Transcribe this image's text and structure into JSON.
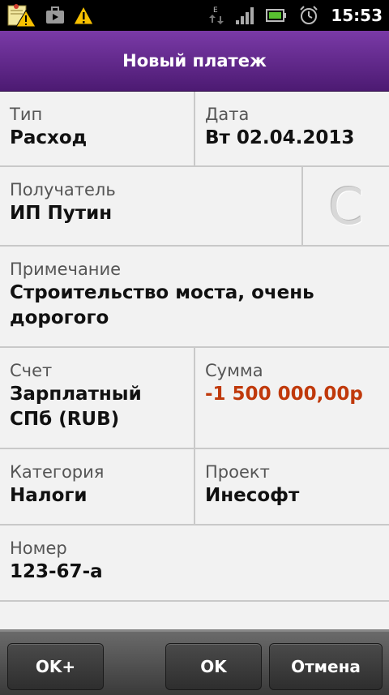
{
  "status_bar": {
    "time": "15:53",
    "icons": [
      "note-warning-icon",
      "briefcase-icon",
      "warning-icon",
      "data-arrows-icon",
      "signal-icon",
      "battery-icon",
      "alarm-icon"
    ],
    "network_type": "E"
  },
  "header": {
    "title": "Новый платеж"
  },
  "form": {
    "type": {
      "label": "Тип",
      "value": "Расход"
    },
    "date": {
      "label": "Дата",
      "value": "Вт 02.04.2013"
    },
    "recipient": {
      "label": "Получатель",
      "value": "ИП Путин"
    },
    "contact_button_glyph": "C",
    "note": {
      "label": "Примечание",
      "value": "Строительство моста, очень дорогого"
    },
    "account": {
      "label": "Счет",
      "value": "Зарплатный СПб (RUB)"
    },
    "amount": {
      "label": "Сумма",
      "value": "-1 500 000,00р"
    },
    "category": {
      "label": "Категория",
      "value": "Налоги"
    },
    "project": {
      "label": "Проект",
      "value": "Инесофт"
    },
    "number": {
      "label": "Номер",
      "value": "123-67-а"
    }
  },
  "buttons": {
    "ok_plus": "OK+",
    "ok": "OK",
    "cancel": "Отмена"
  },
  "colors": {
    "header_purple": "#5e2487",
    "amount_red": "#c0390b"
  }
}
